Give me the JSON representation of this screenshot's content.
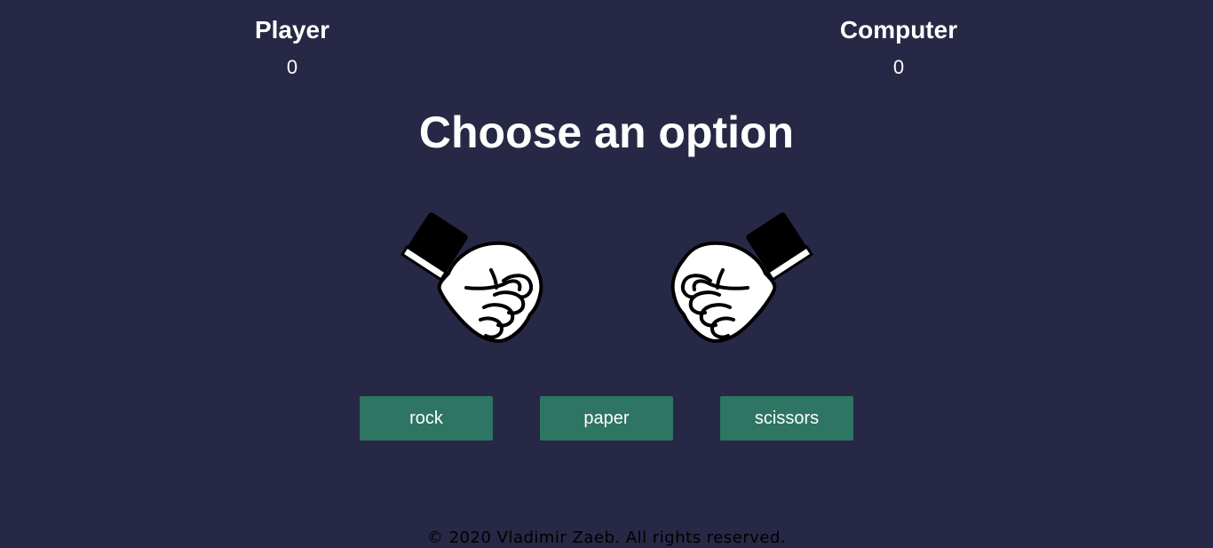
{
  "scoreboard": {
    "player": {
      "label": "Player",
      "score": "0"
    },
    "computer": {
      "label": "Computer",
      "score": "0"
    }
  },
  "title": "Choose an option",
  "hands": {
    "player_icon": "fist-icon",
    "computer_icon": "fist-icon"
  },
  "options": [
    {
      "label": "rock"
    },
    {
      "label": "paper"
    },
    {
      "label": "scissors"
    }
  ],
  "footer": "© 2020 Vladimir Zaeb. All rights reserved.",
  "colors": {
    "background": "#272845",
    "button": "#2e7563",
    "text": "#ffffff",
    "footer_text": "#000000"
  }
}
